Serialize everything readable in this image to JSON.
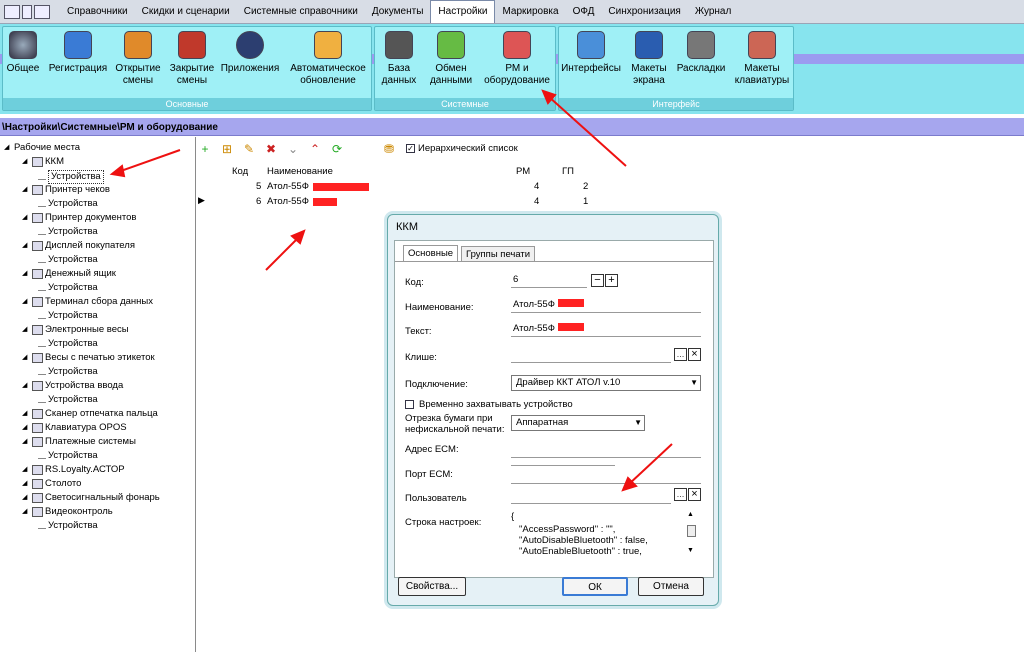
{
  "menubar": {
    "items": [
      "Справочники",
      "Скидки и сценарии",
      "Системные справочники",
      "Документы",
      "Настройки",
      "Маркировка",
      "ОФД",
      "Синхронизация",
      "Журнал"
    ],
    "active": "Настройки"
  },
  "ribbon": {
    "groups": [
      {
        "caption": "Основные",
        "buttons": [
          {
            "label": "Общее",
            "icon": "gear-icon"
          },
          {
            "label": "Регистрация",
            "icon": "registration-icon"
          },
          {
            "label": "Открытие смены",
            "icon": "open-shift-icon"
          },
          {
            "label": "Закрытие смены",
            "icon": "close-shift-icon"
          },
          {
            "label": "Приложения",
            "icon": "apps-icon"
          },
          {
            "label": "Автоматическое обновление",
            "icon": "update-icon"
          }
        ]
      },
      {
        "caption": "Системные",
        "buttons": [
          {
            "label": "База данных",
            "icon": "database-icon"
          },
          {
            "label": "Обмен данными",
            "icon": "exchange-icon"
          },
          {
            "label": "РМ и оборудование",
            "icon": "equipment-icon"
          }
        ]
      },
      {
        "caption": "Интерфейс",
        "buttons": [
          {
            "label": "Интерфейсы",
            "icon": "ok-window-icon"
          },
          {
            "label": "Макеты экрана",
            "icon": "monitor-icon"
          },
          {
            "label": "Раскладки",
            "icon": "keyboard-icon"
          },
          {
            "label": "Макеты клавиатуры",
            "icon": "keypad-icon"
          }
        ]
      }
    ]
  },
  "breadcrumb": "\\Настройки\\Системные\\РМ и оборудование",
  "tree": {
    "root": "Рабочие места",
    "items": [
      {
        "label": "ККМ",
        "level": 1
      },
      {
        "label": "Устройства",
        "level": 2,
        "selected": true
      },
      {
        "label": "Принтер чеков",
        "level": 1
      },
      {
        "label": "Устройства",
        "level": 2
      },
      {
        "label": "Принтер документов",
        "level": 1
      },
      {
        "label": "Устройства",
        "level": 2
      },
      {
        "label": "Дисплей покупателя",
        "level": 1
      },
      {
        "label": "Устройства",
        "level": 2
      },
      {
        "label": "Денежный ящик",
        "level": 1
      },
      {
        "label": "Устройства",
        "level": 2
      },
      {
        "label": "Терминал сбора данных",
        "level": 1
      },
      {
        "label": "Устройства",
        "level": 2
      },
      {
        "label": "Электронные весы",
        "level": 1
      },
      {
        "label": "Устройства",
        "level": 2
      },
      {
        "label": "Весы с печатью этикеток",
        "level": 1
      },
      {
        "label": "Устройства",
        "level": 2
      },
      {
        "label": "Устройства ввода",
        "level": 1
      },
      {
        "label": "Устройства",
        "level": 2
      },
      {
        "label": "Сканер отпечатка пальца",
        "level": 1
      },
      {
        "label": "Клавиатура OPOS",
        "level": 1
      },
      {
        "label": "Платежные системы",
        "level": 1
      },
      {
        "label": "Устройства",
        "level": 2
      },
      {
        "label": "RS.Loyalty.АСТОР",
        "level": 1
      },
      {
        "label": "Столото",
        "level": 1
      },
      {
        "label": "Светосигнальный фонарь",
        "level": 1
      },
      {
        "label": "Видеоконтроль",
        "level": 1
      },
      {
        "label": "Устройства",
        "level": 2
      }
    ]
  },
  "grid": {
    "hierarchical_label": "Иерархический список",
    "headers": {
      "code": "Код",
      "name": "Наименование",
      "rm": "РМ",
      "gp": "ГП"
    },
    "rows": [
      {
        "code": "5",
        "name": "Атол-55Ф",
        "rm": "4",
        "gp": "2"
      },
      {
        "code": "6",
        "name": "Атол-55Ф",
        "rm": "4",
        "gp": "1"
      }
    ]
  },
  "dialog": {
    "title": "ККМ",
    "tabs": [
      "Основные",
      "Группы печати"
    ],
    "fields": {
      "code_label": "Код:",
      "code_value": "6",
      "name_label": "Наименование:",
      "name_value": "Атол-55Ф",
      "text_label": "Текст:",
      "text_value": "Атол-55Ф",
      "cliche_label": "Клише:",
      "connection_label": "Подключение:",
      "connection_value": "Драйвер ККТ АТОЛ v.10",
      "capture_label": "Временно захватывать устройство",
      "cut_label_1": "Отрезка бумаги при",
      "cut_label_2": "нефискальной печати:",
      "cut_value": "Аппаратная",
      "ecm_addr_label": "Адрес ECM:",
      "ecm_port_label": "Порт ECM:",
      "user_label": "Пользователь",
      "settings_label": "Строка настроек:",
      "settings_lines": [
        "{",
        "\"AccessPassword\" : \"\",",
        "\"AutoDisableBluetooth\" : false,",
        "\"AutoEnableBluetooth\" : true,"
      ]
    },
    "buttons": {
      "props": "Свойства...",
      "ok": "ОК",
      "cancel": "Отмена"
    }
  }
}
